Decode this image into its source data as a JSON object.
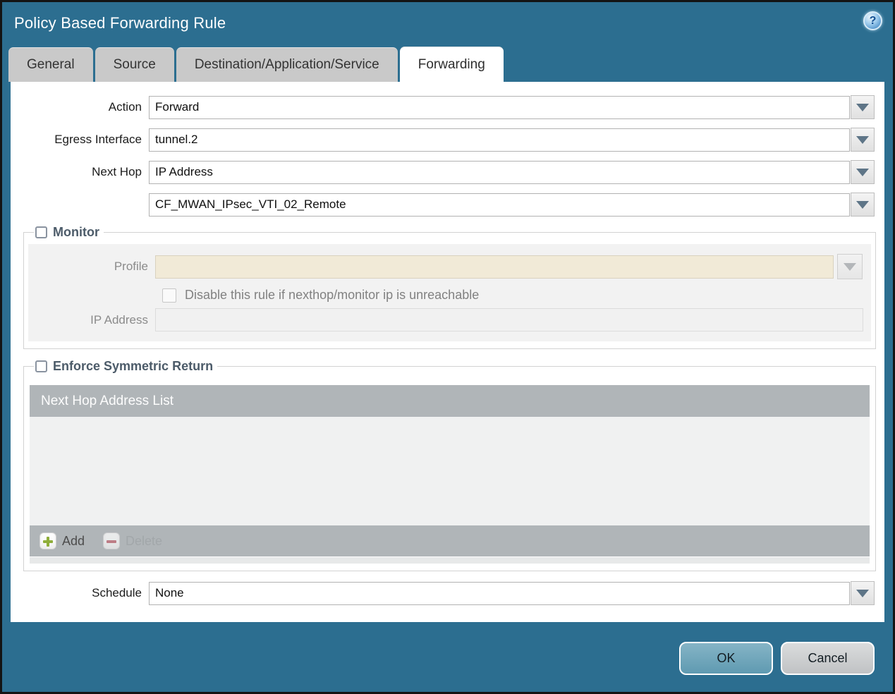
{
  "window": {
    "title": "Policy Based Forwarding Rule",
    "help_icon": "?"
  },
  "tabs": [
    {
      "label": "General",
      "active": false
    },
    {
      "label": "Source",
      "active": false
    },
    {
      "label": "Destination/Application/Service",
      "active": false
    },
    {
      "label": "Forwarding",
      "active": true
    }
  ],
  "form": {
    "action_label": "Action",
    "action_value": "Forward",
    "egress_label": "Egress Interface",
    "egress_value": "tunnel.2",
    "next_hop_label": "Next Hop",
    "next_hop_value": "IP Address",
    "next_hop_address_value": "CF_MWAN_IPsec_VTI_02_Remote",
    "schedule_label": "Schedule",
    "schedule_value": "None"
  },
  "monitor": {
    "title": "Monitor",
    "checked": false,
    "profile_label": "Profile",
    "profile_value": "",
    "disable_label": "Disable this rule if nexthop/monitor ip is unreachable",
    "disable_checked": false,
    "ip_label": "IP Address",
    "ip_value": ""
  },
  "symmetric": {
    "title": "Enforce Symmetric Return",
    "checked": false,
    "list_header": "Next Hop Address List",
    "rows": [],
    "add_label": "Add",
    "delete_label": "Delete"
  },
  "footer": {
    "ok_label": "OK",
    "cancel_label": "Cancel"
  },
  "colors": {
    "titlebar_teal": "#2c6e90",
    "ok_button": "#6fa6bb",
    "add_icon_green": "#8fae3a",
    "delete_icon_red": "#c26b76",
    "table_header_gray": "#b0b5b8",
    "disabled_field_beige": "#f1ead7"
  }
}
